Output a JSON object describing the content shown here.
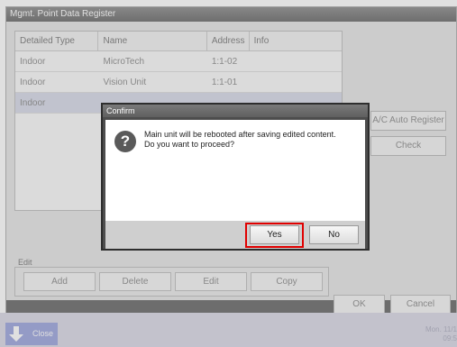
{
  "window": {
    "title": "Mgmt. Point Data Register"
  },
  "table": {
    "columns": [
      "Detailed Type",
      "Name",
      "Address",
      "Info"
    ],
    "rows": [
      {
        "type": "Indoor",
        "name": "MicroTech",
        "address": "1:1-02",
        "info": ""
      },
      {
        "type": "Indoor",
        "name": "Vision Unit",
        "address": "1:1-01",
        "info": ""
      },
      {
        "type": "Indoor",
        "name": "",
        "address": "",
        "info": "",
        "selected": true
      }
    ]
  },
  "side_buttons": {
    "auto_register": "A/C Auto Register",
    "check": "Check"
  },
  "edit": {
    "label": "Edit",
    "add": "Add",
    "delete": "Delete",
    "edit": "Edit",
    "copy": "Copy"
  },
  "footer": {
    "ok": "OK",
    "cancel": "Cancel"
  },
  "taskbar": {
    "close": "Close",
    "clock_line1": "Mon. 11/1",
    "clock_line2": "09:5"
  },
  "dialog": {
    "title": "Confirm",
    "message_line1": "Main unit will be rebooted after saving edited content.",
    "message_line2": "Do you want to proceed?",
    "icon": "question-icon",
    "yes": "Yes",
    "no": "No",
    "highlight_color": "#e00000"
  }
}
